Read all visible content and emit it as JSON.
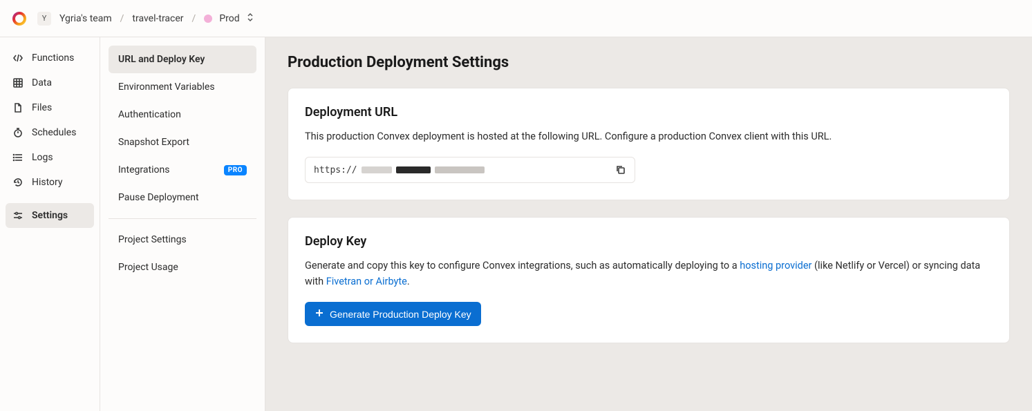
{
  "breadcrumb": {
    "team_initial": "Y",
    "team_name": "Ygria's team",
    "project": "travel-tracer",
    "env": "Prod"
  },
  "primary_nav": [
    {
      "label": "Functions",
      "icon": "code-icon"
    },
    {
      "label": "Data",
      "icon": "table-icon"
    },
    {
      "label": "Files",
      "icon": "file-icon"
    },
    {
      "label": "Schedules",
      "icon": "stopwatch-icon"
    },
    {
      "label": "Logs",
      "icon": "list-icon"
    },
    {
      "label": "History",
      "icon": "history-icon"
    },
    {
      "label": "Settings",
      "icon": "sliders-icon",
      "active": true
    }
  ],
  "secondary_nav": {
    "group1": [
      {
        "label": "URL and Deploy Key",
        "active": true
      },
      {
        "label": "Environment Variables"
      },
      {
        "label": "Authentication"
      },
      {
        "label": "Snapshot Export"
      },
      {
        "label": "Integrations",
        "badge": "PRO"
      },
      {
        "label": "Pause Deployment"
      }
    ],
    "group2": [
      {
        "label": "Project Settings"
      },
      {
        "label": "Project Usage"
      }
    ]
  },
  "page": {
    "title": "Production Deployment Settings"
  },
  "deployment_url_card": {
    "heading": "Deployment URL",
    "description": "This production Convex deployment is hosted at the following URL. Configure a production Convex client with this URL.",
    "url_prefix": "https://"
  },
  "deploy_key_card": {
    "heading": "Deploy Key",
    "desc_part1": "Generate and copy this key to configure Convex integrations, such as automatically deploying to a ",
    "link1_text": "hosting provider",
    "desc_part2": " (like Netlify or Vercel) or syncing data with ",
    "link2_text": "Fivetran or Airbyte",
    "desc_part3": ".",
    "button_label": "Generate Production Deploy Key"
  }
}
